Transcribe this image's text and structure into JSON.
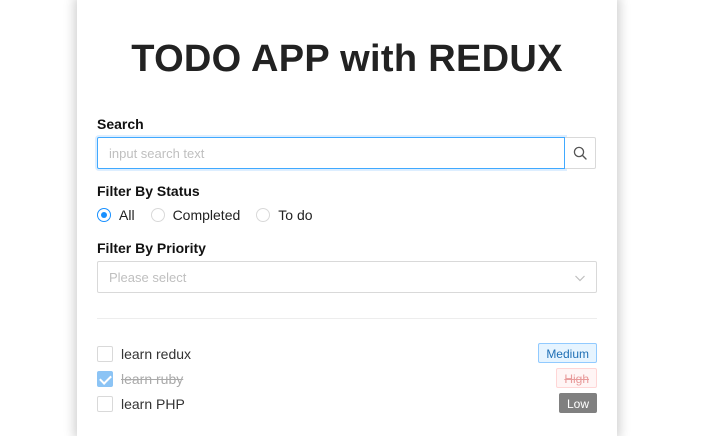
{
  "app": {
    "title": "TODO APP with REDUX"
  },
  "search": {
    "label": "Search",
    "placeholder": "input search text",
    "value": ""
  },
  "status_filter": {
    "label": "Filter By Status",
    "options": [
      {
        "label": "All",
        "checked": true
      },
      {
        "label": "Completed",
        "checked": false
      },
      {
        "label": "To do",
        "checked": false
      }
    ]
  },
  "priority_filter": {
    "label": "Filter By Priority",
    "placeholder": "Please select"
  },
  "todos": [
    {
      "text": "learn redux",
      "completed": false,
      "priority": "Medium"
    },
    {
      "text": "learn ruby",
      "completed": true,
      "priority": "High"
    },
    {
      "text": "learn PHP",
      "completed": false,
      "priority": "Low"
    }
  ],
  "colors": {
    "accent": "#1890ff",
    "medium_tag": "#e6f4ff",
    "high_tag": "#fff5f5",
    "low_tag": "#808080"
  }
}
